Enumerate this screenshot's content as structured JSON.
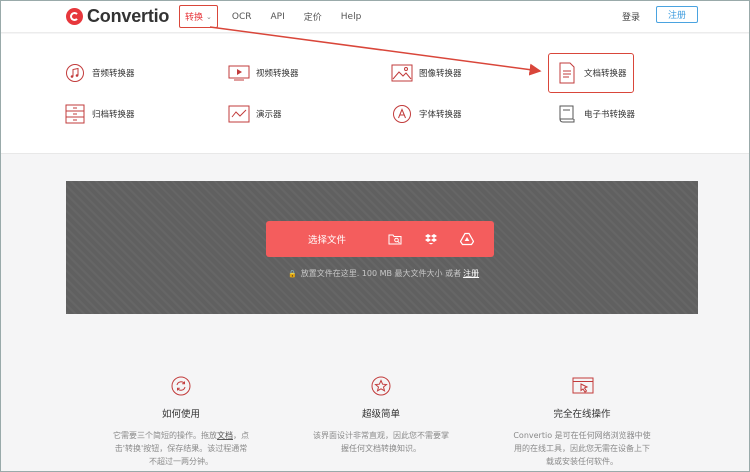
{
  "header": {
    "logo_text": "Convertio",
    "nav": [
      {
        "label": "转换"
      },
      {
        "label": "OCR"
      },
      {
        "label": "API"
      },
      {
        "label": "定价"
      },
      {
        "label": "Help"
      }
    ],
    "login_label": "登录",
    "signup_label": "注册"
  },
  "menu": {
    "items": [
      {
        "label": "音频转换器",
        "icon": "music-note-icon"
      },
      {
        "label": "视频转换器",
        "icon": "video-icon"
      },
      {
        "label": "图像转换器",
        "icon": "image-icon"
      },
      {
        "label": "文档转换器",
        "icon": "document-icon"
      },
      {
        "label": "归档转换器",
        "icon": "archive-icon"
      },
      {
        "label": "演示器",
        "icon": "presentation-icon"
      },
      {
        "label": "字体转换器",
        "icon": "font-icon"
      },
      {
        "label": "电子书转换器",
        "icon": "ebook-icon"
      }
    ]
  },
  "upload": {
    "choose_label": "选择文件",
    "drop_note": "放置文件在这里. 100 MB 最大文件大小 或者",
    "register_link": "注册"
  },
  "features": [
    {
      "title": "如何使用",
      "desc1": "它需要三个简短的操作。拖放",
      "link": "文档",
      "desc1b": "，点",
      "desc2": "击'转换'按钮，保存结果。该过程通常",
      "desc3": "不超过一两分钟。",
      "icon": "refresh-icon"
    },
    {
      "title": "超级简单",
      "desc1": "该界面设计非常直观，因此您不需要掌",
      "desc2": "握任何文档转换知识。",
      "icon": "star-icon"
    },
    {
      "title": "完全在线操作",
      "desc1": "Convertio 是可在任何网络浏览器中使",
      "desc2": "用的在线工具，因此您无需在设备上下",
      "desc3": "载或安装任何软件。",
      "icon": "browser-cursor-icon"
    }
  ],
  "colors": {
    "brand": "#e7373c",
    "upload_button": "#f45d5d",
    "annotation": "#d9463a",
    "signup_border": "#4aa3e0"
  }
}
